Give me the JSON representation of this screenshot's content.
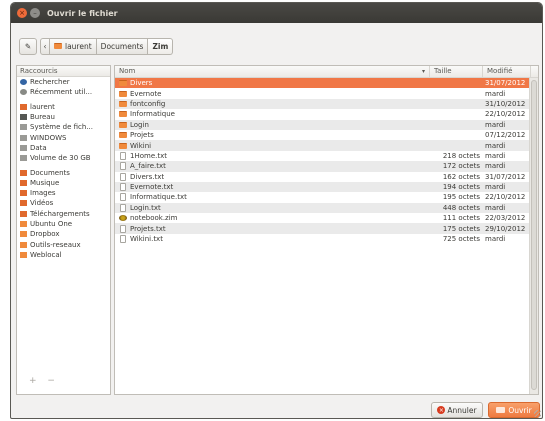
{
  "window": {
    "title": "Ouvrir le fichier"
  },
  "pathbar": {
    "crumbs": [
      "laurent",
      "Documents",
      "Zim"
    ]
  },
  "places": {
    "header": "Raccourcis",
    "items": [
      {
        "label": "Rechercher",
        "icon": "search-icon"
      },
      {
        "label": "Récemment util...",
        "icon": "clock-icon"
      },
      {
        "label": "laurent",
        "icon": "home-folder-icon"
      },
      {
        "label": "Bureau",
        "icon": "desktop-icon"
      },
      {
        "label": "Système de fich...",
        "icon": "drive-icon"
      },
      {
        "label": "WINDOWS",
        "icon": "drive-icon"
      },
      {
        "label": "Data",
        "icon": "drive-icon"
      },
      {
        "label": "Volume de 30 GB",
        "icon": "drive-icon"
      },
      {
        "label": "Documents",
        "icon": "documents-folder-icon"
      },
      {
        "label": "Musique",
        "icon": "music-folder-icon"
      },
      {
        "label": "Images",
        "icon": "pictures-folder-icon"
      },
      {
        "label": "Vidéos",
        "icon": "videos-folder-icon"
      },
      {
        "label": "Téléchargements",
        "icon": "downloads-folder-icon"
      },
      {
        "label": "Ubuntu One",
        "icon": "folder-icon"
      },
      {
        "label": "Dropbox",
        "icon": "folder-icon"
      },
      {
        "label": "Outils-reseaux",
        "icon": "folder-icon"
      },
      {
        "label": "Weblocal",
        "icon": "folder-icon"
      }
    ],
    "add_label": "+",
    "remove_label": "−"
  },
  "files": {
    "columns": {
      "name": "Nom",
      "size": "Taille",
      "date": "Modifié"
    },
    "rows": [
      {
        "name": "Divers",
        "size": "",
        "date": "31/07/2012",
        "type": "folder",
        "selected": true
      },
      {
        "name": "Evernote",
        "size": "",
        "date": "mardi",
        "type": "folder"
      },
      {
        "name": "fontconfig",
        "size": "",
        "date": "31/10/2012",
        "type": "folder"
      },
      {
        "name": "Informatique",
        "size": "",
        "date": "22/10/2012",
        "type": "folder"
      },
      {
        "name": "Login",
        "size": "",
        "date": "mardi",
        "type": "folder"
      },
      {
        "name": "Projets",
        "size": "",
        "date": "07/12/2012",
        "type": "folder"
      },
      {
        "name": "Wikini",
        "size": "",
        "date": "mardi",
        "type": "folder"
      },
      {
        "name": "1Home.txt",
        "size": "218 octets",
        "date": "mardi",
        "type": "doc"
      },
      {
        "name": "A_faire.txt",
        "size": "172 octets",
        "date": "mardi",
        "type": "doc"
      },
      {
        "name": "Divers.txt",
        "size": "162 octets",
        "date": "31/07/2012",
        "type": "doc"
      },
      {
        "name": "Evernote.txt",
        "size": "194 octets",
        "date": "mardi",
        "type": "doc"
      },
      {
        "name": "Informatique.txt",
        "size": "195 octets",
        "date": "22/10/2012",
        "type": "doc"
      },
      {
        "name": "Login.txt",
        "size": "448 octets",
        "date": "mardi",
        "type": "doc"
      },
      {
        "name": "notebook.zim",
        "size": "111 octets",
        "date": "22/03/2012",
        "type": "zim"
      },
      {
        "name": "Projets.txt",
        "size": "175 octets",
        "date": "29/10/2012",
        "type": "doc"
      },
      {
        "name": "Wikini.txt",
        "size": "725 octets",
        "date": "mardi",
        "type": "doc"
      }
    ]
  },
  "buttons": {
    "cancel": "Annuler",
    "open": "Ouvrir"
  },
  "colors": {
    "accent": "#f07746",
    "titlebar": "#3c3b37",
    "close": "#ef6b3a"
  }
}
